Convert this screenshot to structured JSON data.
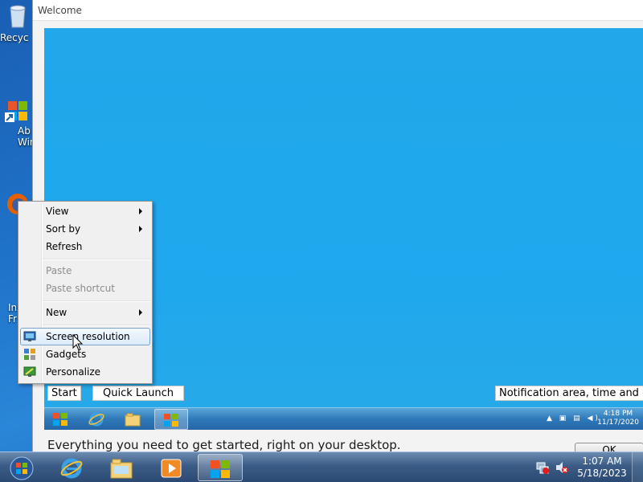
{
  "desktop_icons": [
    {
      "name": "recycle-bin-icon",
      "label": "Recyc"
    },
    {
      "name": "shortcut-icon",
      "label": "Ab Wind"
    },
    {
      "name": "firefox-icon",
      "label": ""
    },
    {
      "name": "installer-icon",
      "label": "Ins Fr"
    }
  ],
  "welcome_window": {
    "title": "Welcome",
    "body_text": "Everything you need to get started, right on your desktop.",
    "ok_label": "OK"
  },
  "preview": {
    "start_label": "Start",
    "quick_launch_label": "Quick Launch",
    "notification_label": "Notification area, time and date",
    "tray_time": "4:18 PM",
    "tray_date": "11/17/2020"
  },
  "context_menu": {
    "items": [
      {
        "label": "View",
        "submenu": true,
        "enabled": true
      },
      {
        "label": "Sort by",
        "submenu": true,
        "enabled": true
      },
      {
        "label": "Refresh",
        "submenu": false,
        "enabled": true
      },
      {
        "label": "Paste",
        "submenu": false,
        "enabled": false
      },
      {
        "label": "Paste shortcut",
        "submenu": false,
        "enabled": false
      },
      {
        "label": "New",
        "submenu": true,
        "enabled": true
      },
      {
        "label": "Screen resolution",
        "submenu": false,
        "enabled": true,
        "highlighted": true,
        "icon": "screen-resolution-icon"
      },
      {
        "label": "Gadgets",
        "submenu": false,
        "enabled": true,
        "icon": "gadgets-icon"
      },
      {
        "label": "Personalize",
        "submenu": false,
        "enabled": true,
        "icon": "personalize-icon"
      }
    ]
  },
  "taskbar": {
    "items": [
      "start-orb",
      "internet-explorer",
      "windows-explorer",
      "media-player",
      "welcome-center"
    ],
    "active_item": "welcome-center",
    "clock_time": "1:07 AM",
    "clock_date": "5/18/2023"
  },
  "colors": {
    "desktop": "#1e72c8",
    "preview_background": "#21a7ea",
    "menu_highlight_border": "#7da2ce",
    "taskbar": "#3b5c86"
  }
}
